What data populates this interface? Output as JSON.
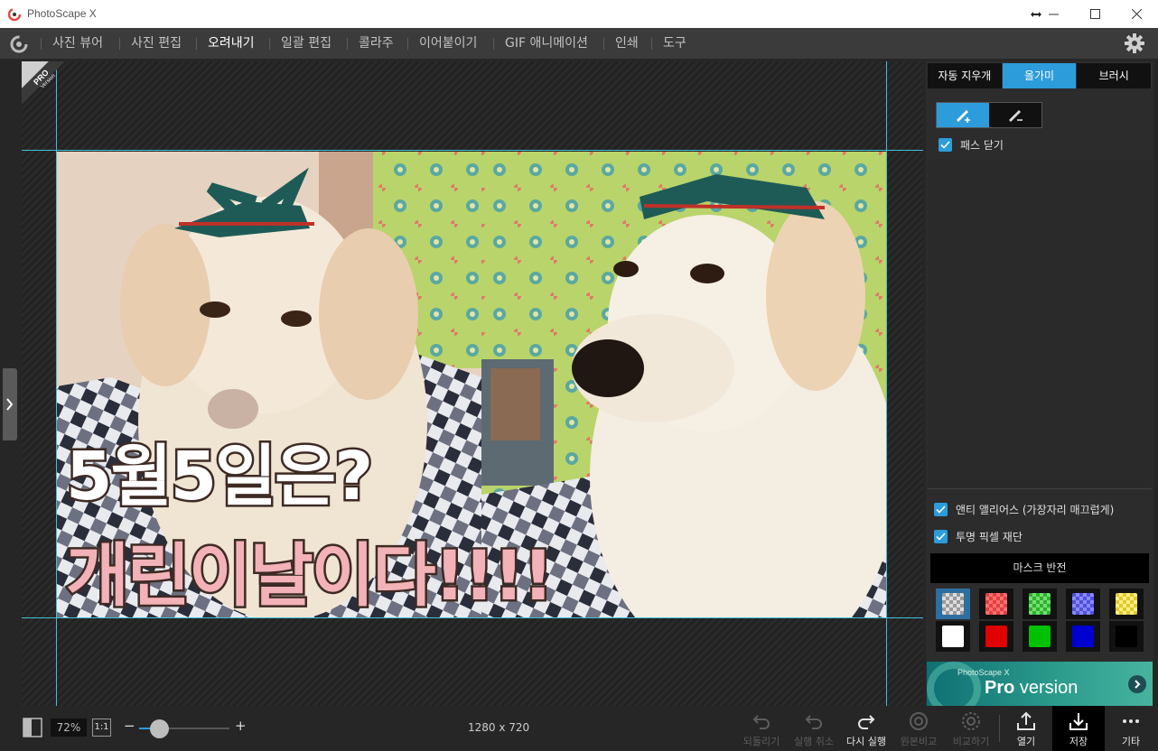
{
  "window": {
    "title": "PhotoScape X"
  },
  "menu": {
    "items": [
      {
        "label": "사진 뷰어",
        "active": false
      },
      {
        "label": "사진 편집",
        "active": false
      },
      {
        "label": "오려내기",
        "active": true
      },
      {
        "label": "일괄 편집",
        "active": false
      },
      {
        "label": "콜라주",
        "active": false
      },
      {
        "label": "이어붙이기",
        "active": false
      },
      {
        "label": "GIF 애니메이션",
        "active": false
      },
      {
        "label": "인쇄",
        "active": false
      },
      {
        "label": "도구",
        "active": false
      }
    ]
  },
  "canvas": {
    "badge": {
      "line1": "PRO",
      "line2": "Version"
    },
    "caption_line1": "5월5일은?",
    "caption_line2": "개린이날이다!!!!"
  },
  "panel": {
    "tabs": [
      {
        "label": "자동 지우개",
        "active": false
      },
      {
        "label": "올가미",
        "active": true
      },
      {
        "label": "브러시",
        "active": false
      }
    ],
    "close_path_label": "패스 닫기",
    "antialias_label": "앤티 앨리어스 (가장자리 매끄럽게)",
    "transparent_cut_label": "투명 픽셀 재단",
    "mask_invert_label": "마스크 반전",
    "swatches": [
      {
        "name": "transparent",
        "color": "checker",
        "selected": true
      },
      {
        "name": "red-checker",
        "color": "#ff5555"
      },
      {
        "name": "green-checker",
        "color": "#44d044"
      },
      {
        "name": "blue-checker",
        "color": "#6a6aff"
      },
      {
        "name": "yellow-checker",
        "color": "#ffe44a"
      },
      {
        "name": "white",
        "color": "#ffffff"
      },
      {
        "name": "red",
        "color": "#e00000"
      },
      {
        "name": "green",
        "color": "#00c000"
      },
      {
        "name": "blue",
        "color": "#0000d0"
      },
      {
        "name": "black",
        "color": "#000000"
      }
    ],
    "promo": {
      "small": "PhotoScape X",
      "big_bold": "Pro",
      "big_rest": " version"
    }
  },
  "bottom": {
    "zoom_percent": "72%",
    "one_to_one": "1:1",
    "zoom_level_fraction": 0.22,
    "image_size": "1280 x 720",
    "actions": [
      {
        "label": "되돌리기",
        "icon": "revert-icon",
        "enabled": false
      },
      {
        "label": "실행 취소",
        "icon": "undo-icon",
        "enabled": false
      },
      {
        "label": "다시 실행",
        "icon": "redo-icon",
        "enabled": true
      },
      {
        "label": "원본비교",
        "icon": "compare-original-icon",
        "enabled": false
      },
      {
        "label": "비교하기",
        "icon": "compare-icon",
        "enabled": false
      },
      {
        "label": "열기",
        "icon": "open-icon",
        "enabled": true
      },
      {
        "label": "저장",
        "icon": "save-icon",
        "enabled": true,
        "selected": true
      },
      {
        "label": "기타",
        "icon": "more-icon",
        "enabled": true
      }
    ]
  },
  "colors": {
    "accent": "#2d9cdb",
    "guide": "#3fc2d6"
  }
}
